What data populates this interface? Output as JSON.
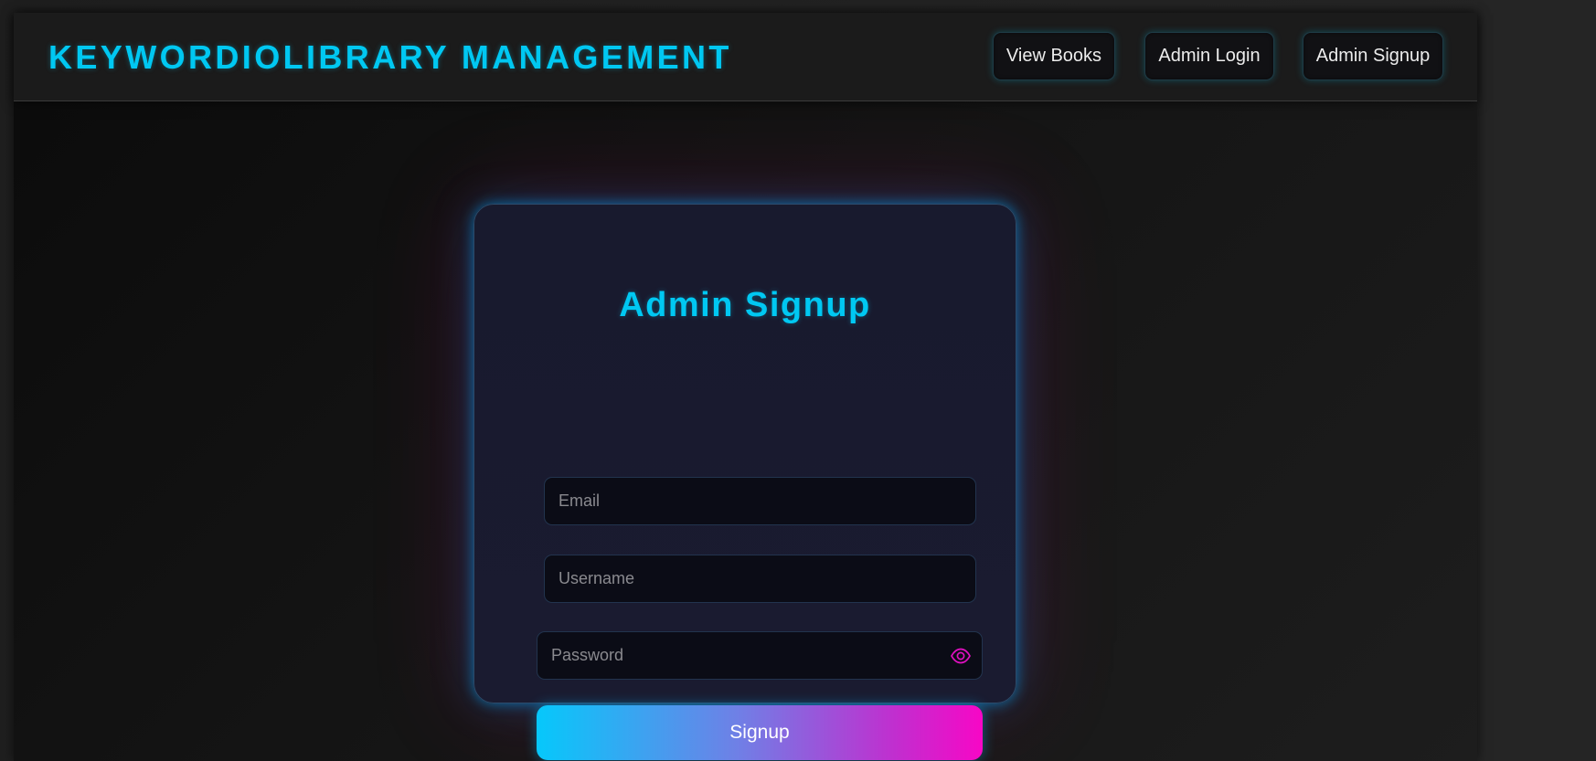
{
  "header": {
    "brand": "KEYWORDIOLIBRARY MANAGEMENT",
    "nav": [
      {
        "label": "View Books"
      },
      {
        "label": "Admin Login"
      },
      {
        "label": "Admin Signup"
      }
    ]
  },
  "form": {
    "title": "Admin Signup",
    "email": {
      "placeholder": "Email",
      "value": ""
    },
    "username": {
      "placeholder": "Username",
      "value": ""
    },
    "password": {
      "placeholder": "Password",
      "value": "",
      "toggle_icon": "eye-icon"
    },
    "submit_label": "Signup"
  },
  "colors": {
    "accent_cyan": "#00c8f2",
    "accent_magenta": "#f707c6",
    "card_bg": "#181a2e",
    "page_bg": "#141414"
  }
}
